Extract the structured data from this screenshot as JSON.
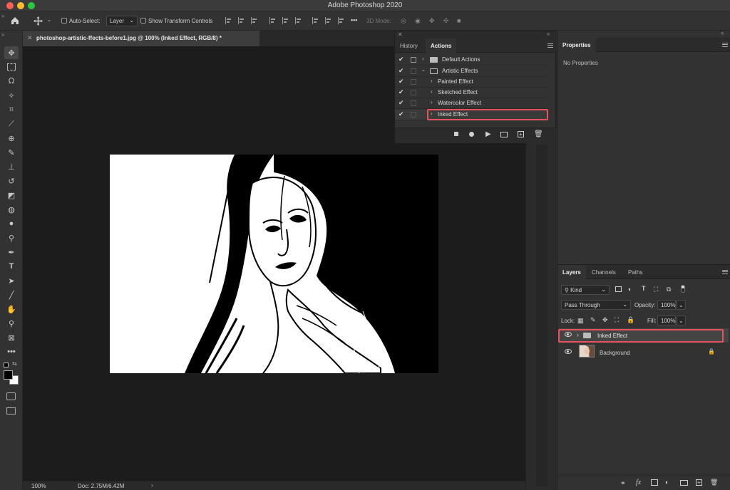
{
  "window": {
    "title": "Adobe Photoshop 2020",
    "colors": {
      "close": "#fe5f57",
      "minimize": "#febc2e",
      "maximize": "#28c840"
    }
  },
  "options_bar": {
    "auto_select_label": "Auto-Select:",
    "auto_select_value": "Layer",
    "show_transform_label": "Show Transform Controls",
    "three_d_mode_label": "3D Mode:",
    "more_label": "•••"
  },
  "document": {
    "tab_title": "photoshop-artistic-ffects-before1.jpg @ 100% (Inked Effect, RGB/8) *"
  },
  "status_bar": {
    "zoom": "100%",
    "doc_info": "Doc: 2.75M/6.42M"
  },
  "actions_panel": {
    "tabs": [
      {
        "label": "History",
        "active": false
      },
      {
        "label": "Actions",
        "active": true
      }
    ],
    "rows": [
      {
        "label": "Default Actions",
        "level": 0,
        "type": "set",
        "expanded": false,
        "checked": true,
        "dialog": true
      },
      {
        "label": "Artistic Effects",
        "level": 0,
        "type": "set",
        "expanded": true,
        "checked": true,
        "dialog": false
      },
      {
        "label": "Painted Effect",
        "level": 1,
        "type": "action",
        "expanded": false,
        "checked": true,
        "dialog": false
      },
      {
        "label": "Sketched Effect",
        "level": 1,
        "type": "action",
        "expanded": false,
        "checked": true,
        "dialog": false
      },
      {
        "label": "Watercolor Effect",
        "level": 1,
        "type": "action",
        "expanded": false,
        "checked": true,
        "dialog": false
      },
      {
        "label": "Inked Effect",
        "level": 1,
        "type": "action",
        "expanded": false,
        "checked": true,
        "dialog": false,
        "highlighted": true
      }
    ]
  },
  "properties_panel": {
    "tab": "Properties",
    "empty_text": "No Properties"
  },
  "layers_panel": {
    "tabs": [
      {
        "label": "Layers",
        "active": true
      },
      {
        "label": "Channels",
        "active": false
      },
      {
        "label": "Paths",
        "active": false
      }
    ],
    "filter_kind": "Kind",
    "blend_mode": "Pass Through",
    "opacity_label": "Opacity:",
    "opacity_value": "100%",
    "lock_label": "Lock:",
    "fill_label": "Fill:",
    "fill_value": "100%",
    "layers": [
      {
        "name": "Inked Effect",
        "type": "group",
        "visible": true,
        "highlighted": true
      },
      {
        "name": "Background",
        "type": "image",
        "visible": true,
        "locked": true
      }
    ],
    "footer_fx": "fx"
  },
  "accent": {
    "highlight": "#e8525b"
  }
}
